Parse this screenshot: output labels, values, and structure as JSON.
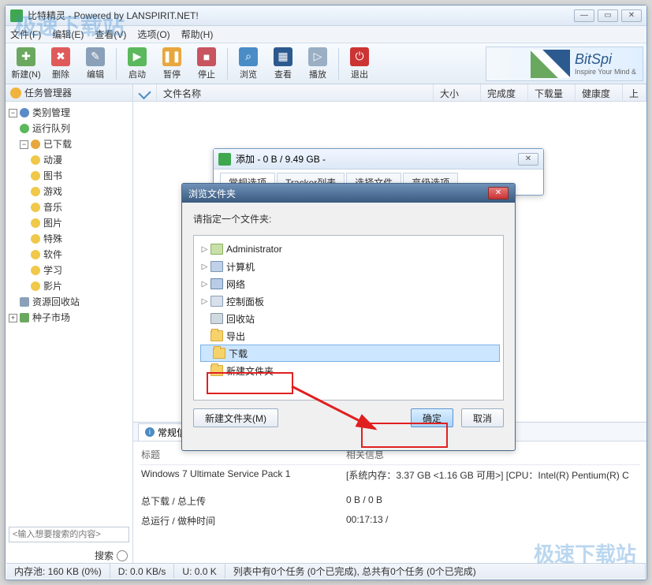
{
  "window": {
    "title": "比特精灵 - Powered by LANSPIRIT.NET!"
  },
  "menu": {
    "file": "文件(F)",
    "edit": "编辑(E)",
    "view": "查看(V)",
    "options": "选项(O)",
    "help": "帮助(H)"
  },
  "toolbar": {
    "new": "新建(N)",
    "delete": "删除",
    "edit": "编辑",
    "start": "启动",
    "pause": "暂停",
    "stop": "停止",
    "browse": "浏览",
    "view": "查看",
    "play": "播放",
    "exit": "退出"
  },
  "logo": {
    "name": "BitSpi",
    "tagline": "Inspire Your Mind &"
  },
  "sidebar": {
    "title": "任务管理器",
    "tree": {
      "category": "类别管理",
      "run_queue": "运行队列",
      "downloaded": "已下载",
      "leaves": [
        "动漫",
        "图书",
        "游戏",
        "音乐",
        "图片",
        "特殊",
        "软件",
        "学习",
        "影片"
      ],
      "recycle": "资源回收站",
      "seed_market": "种子市场"
    },
    "search_placeholder": "<输入想要搜索的内容>",
    "search_label": "搜索"
  },
  "columns": {
    "filename": "文件名称",
    "size": "大小",
    "completion": "完成度",
    "download": "下载量",
    "health": "健康度",
    "up": "上"
  },
  "info_pane": {
    "tab": "常规信",
    "headers": {
      "title": "标题",
      "related": "相关信息"
    },
    "rows": [
      {
        "t": "Windows 7 Ultimate Service Pack 1",
        "v": "[系统内存：3.37 GB <1.16 GB 可用>] [CPU：Intel(R) Pentium(R) C"
      },
      {
        "t": "",
        "v": ""
      },
      {
        "t": "总下载 / 总上传",
        "v": "0 B / 0 B"
      },
      {
        "t": "总运行 / 做种时间",
        "v": "00:17:13 /"
      }
    ]
  },
  "status": {
    "mem": "内存池: 160 KB (0%)",
    "disk": "D: 0.0 KB/s",
    "up": "U: 0.0 K",
    "tasks": "列表中有0个任务 (0个已完成), 总共有0个任务 (0个已完成)"
  },
  "add_dialog": {
    "title": "添加 - 0 B / 9.49 GB -",
    "tabs": [
      "常规选项",
      "Tracker列表",
      "选择文件",
      "高级选项"
    ]
  },
  "browse_dialog": {
    "title": "浏览文件夹",
    "message": "请指定一个文件夹:",
    "items": [
      {
        "label": "Administrator",
        "ico": "user",
        "exp": true
      },
      {
        "label": "计算机",
        "ico": "computer",
        "exp": true
      },
      {
        "label": "网络",
        "ico": "network",
        "exp": true
      },
      {
        "label": "控制面板",
        "ico": "panel",
        "exp": true
      },
      {
        "label": "回收站",
        "ico": "recycle",
        "exp": false
      },
      {
        "label": "导出",
        "ico": "folder",
        "exp": false
      },
      {
        "label": "下载",
        "ico": "folder",
        "exp": false,
        "selected": true
      },
      {
        "label": "新建文件夹",
        "ico": "folder",
        "exp": false
      }
    ],
    "new_folder": "新建文件夹(M)",
    "ok": "确定",
    "cancel": "取消"
  },
  "watermark": "极速下载站"
}
